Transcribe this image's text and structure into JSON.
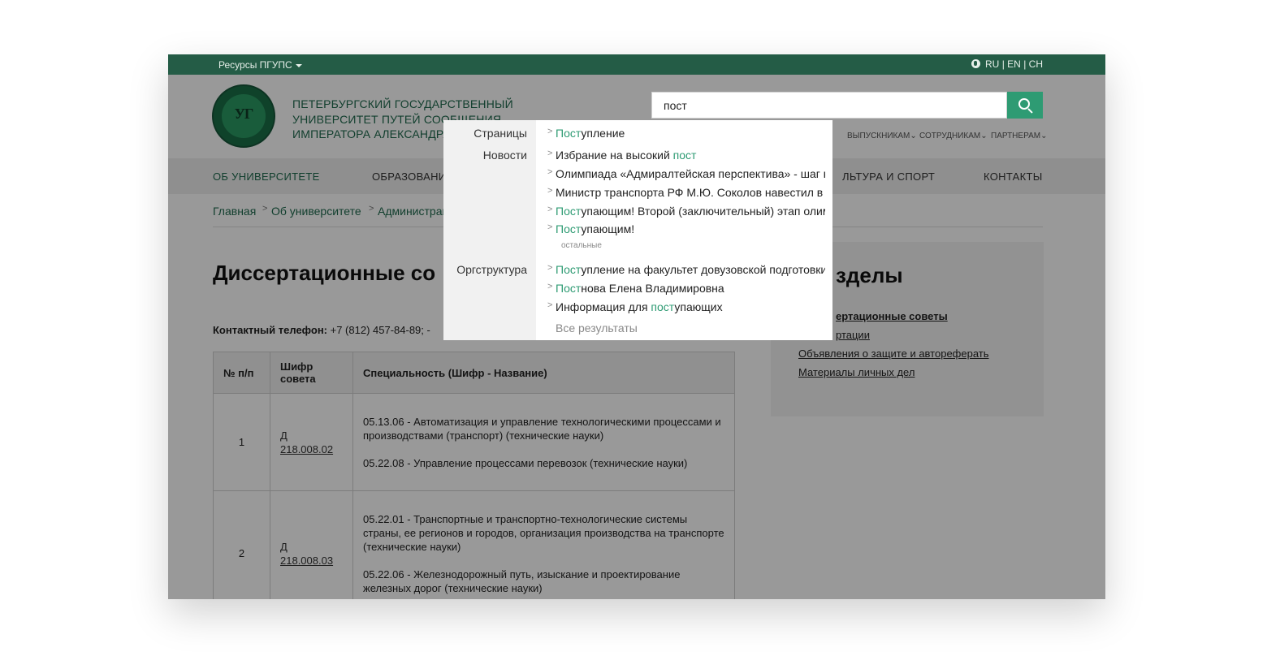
{
  "topbar": {
    "resources": "Ресурсы ПГУПС",
    "lang_ru": "RU",
    "lang_en": "EN",
    "lang_ch": "CH",
    "sep": "|"
  },
  "header": {
    "uni_line1": "ПЕТЕРБУРГСКИЙ ГОСУДАРСТВЕННЫЙ",
    "uni_line2": "УНИВЕРСИТЕТ ПУТЕЙ СООБЩЕНИЯ",
    "uni_line3": "ИМПЕРАТОРА АЛЕКСАНДРА I",
    "logo_text": "УГ",
    "search_value": "пост",
    "subnav": [
      "ВЫПУСКНИКАМ",
      "СОТРУДНИКАМ",
      "ПАРТНЕРАМ"
    ]
  },
  "mainnav": [
    "ОБ УНИВЕРСИТЕТЕ",
    "ОБРАЗОВАНИ",
    "ЛЬТУРА И СПОРТ",
    "КОНТАКТЫ"
  ],
  "breadcrumb": [
    "Главная",
    "Об университете",
    "Администрац"
  ],
  "page": {
    "title": "Диссертационные со",
    "phone_label": "Контактный телефон:",
    "phone_value": "+7 (812) 457-84-89; -"
  },
  "table": {
    "headers": [
      "№ п/п",
      "Шифр совета",
      "Специальность (Шифр - Название)"
    ],
    "rows": [
      {
        "num": "1",
        "code": "Д 218.008.02",
        "spec1": "05.13.06 - Автоматизация и управление технологическими процессами и производствами (транспорт) (технические науки)",
        "spec2": "05.22.08 - Управление процессами перевозок (технические науки)"
      },
      {
        "num": "2",
        "code": "Д 218.008.03",
        "spec1": "05.22.01 - Транспортные и транспортно-технологические системы страны, ее регионов и городов, организация производства на транспорте (технические науки)",
        "spec2": "05.22.06 - Железнодорожный путь, изыскание и проектирование железных дорог (технические науки)"
      }
    ]
  },
  "sidebar": {
    "title": "зделы",
    "links": [
      "ертационные советы",
      "ртации",
      "Объявления о защите и автореферать",
      "Материалы личных дел"
    ]
  },
  "dropdown": {
    "cat_pages": "Страницы",
    "cat_news": "Новости",
    "cat_org": "Оргструктура",
    "pages": [
      {
        "hl": "Пост",
        "rest": "упление"
      }
    ],
    "news": [
      {
        "pre": "Избрание на высокий ",
        "hl": "пост",
        "rest": ""
      },
      {
        "pre": "Олимпиада «Адмиралтейская перспектива» - шаг к",
        "hl": "",
        "rest": ""
      },
      {
        "pre": "Министр транспорта РФ М.Ю. Соколов навестил в",
        "hl": "",
        "rest": ""
      },
      {
        "pre": "",
        "hl": "Пост",
        "rest": "упающим! Второй (заключительный) этап олим"
      },
      {
        "pre": "",
        "hl": "Пост",
        "rest": "упающим!"
      }
    ],
    "news_more": "остальные",
    "org": [
      {
        "pre": "",
        "hl": "Пост",
        "rest": "упление на факультет довузовской подготовки"
      },
      {
        "pre": "",
        "hl": "Пост",
        "rest": "нова Елена Владимировна"
      },
      {
        "pre": "Информация для ",
        "hl": "пост",
        "rest": "упающих"
      }
    ],
    "all_results": "Все результаты"
  },
  "colors": {
    "brand_green": "#245c46",
    "accent": "#2e9b73"
  }
}
